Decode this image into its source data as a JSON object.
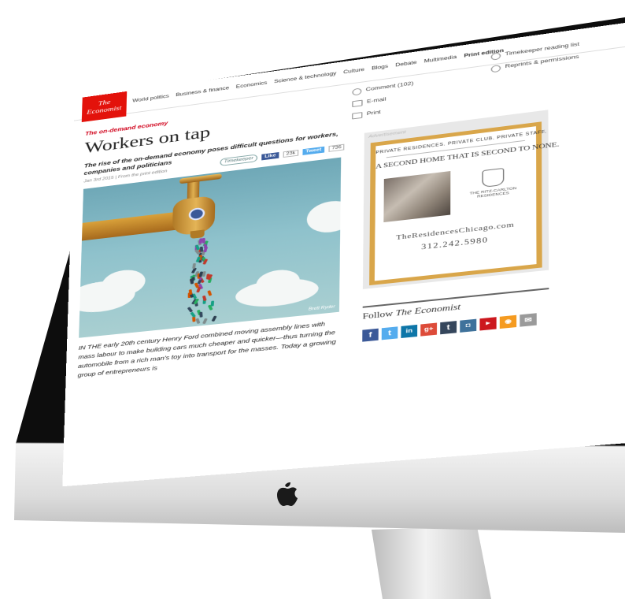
{
  "nav": {
    "logo_line1": "The",
    "logo_line2": "Economist",
    "items": [
      "World politics",
      "Business & finance",
      "Economics",
      "Science & technology",
      "Culture",
      "Blogs",
      "Debate",
      "Multimedia",
      "Print edition"
    ]
  },
  "article": {
    "kicker": "The on-demand economy",
    "headline": "Workers on tap",
    "rubric": "The rise of the on-demand economy poses difficult questions for workers, companies and politicians",
    "dateline": "Jan 3rd 2015 | From the print edition",
    "image_credit": "Brett Ryder",
    "body": "IN THE early 20th century Henry Ford combined moving assembly lines with mass labour to make building cars much cheaper and quicker—thus turning the automobile from a rich man's toy into transport for the masses. Today a growing group of entrepreneurs is"
  },
  "share": {
    "timekeeper": "Timekeeper",
    "like": "Like",
    "like_count": "23k",
    "tweet": "Tweet",
    "tweet_count": "736"
  },
  "tools": {
    "comment": "Comment (102)",
    "email": "E-mail",
    "print": "Print",
    "timekeeper_list": "Timekeeper reading list",
    "reprints": "Reprints & permissions"
  },
  "ad": {
    "label": "Advertisement",
    "top": "PRIVATE RESIDENCES. PRIVATE CLUB. PRIVATE STAFF.",
    "headline": "A SECOND HOME THAT IS SECOND TO NONE.",
    "logo_text": "THE RITZ-CARLTON RESIDENCES",
    "url": "TheResidencesChicago.com",
    "phone": "312.242.5980"
  },
  "follow": {
    "prefix": "Follow",
    "brand": "The Economist",
    "icons": [
      "facebook-icon",
      "twitter-icon",
      "linkedin-icon",
      "googleplus-icon",
      "tumblr-icon",
      "instagram-icon",
      "youtube-icon",
      "rss-icon",
      "email-icon"
    ]
  },
  "colors": {
    "economist_red": "#e3120b",
    "facebook": "#3b5998",
    "twitter": "#55acee",
    "ad_border": "#d9a64a"
  }
}
